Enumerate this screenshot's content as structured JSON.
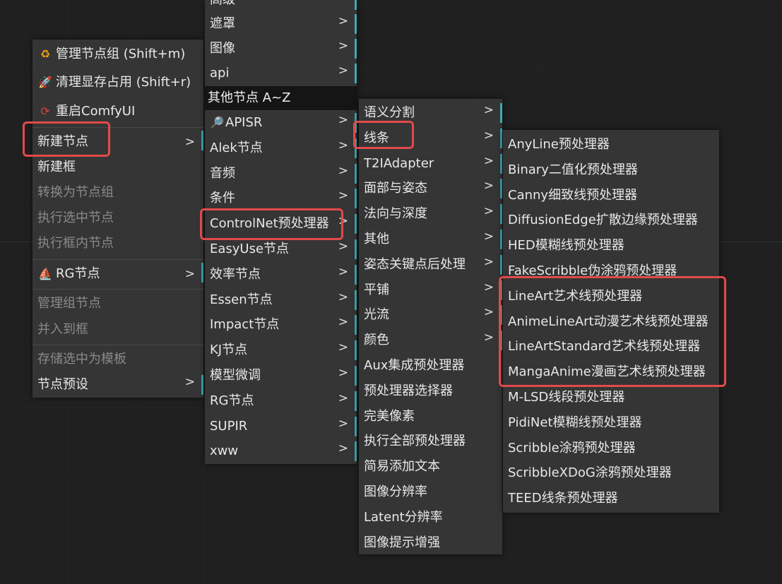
{
  "menu1": {
    "items": [
      {
        "label": "管理节点组 (Shift+m)",
        "icon": "hierarchy-icon"
      },
      {
        "label": "清理显存占用 (Shift+r)",
        "icon": "rocket-icon"
      },
      {
        "label": "重启ComfyUI",
        "icon": "restart-icon"
      },
      {
        "label": "新建节点"
      },
      {
        "label": "新建框"
      },
      {
        "label": "转换为节点组"
      },
      {
        "label": "执行选中节点"
      },
      {
        "label": "执行框内节点"
      },
      {
        "label": "RG节点",
        "icon": "sailboat-icon"
      },
      {
        "label": "管理组节点"
      },
      {
        "label": "并入到框"
      },
      {
        "label": "存储选中为模板"
      },
      {
        "label": "节点预设"
      }
    ]
  },
  "menu2": {
    "top_items": [
      "高级",
      "遮罩",
      "图像",
      "api"
    ],
    "header": "其他节点 A~Z",
    "items": [
      "APISR",
      "Alek节点",
      "音频",
      "条件",
      "ControlNet预处理器",
      "EasyUse节点",
      "效率节点",
      "Essen节点",
      "Impact节点",
      "KJ节点",
      "模型微调",
      "RG节点",
      "SUPIR",
      "xww"
    ]
  },
  "menu3": {
    "items": [
      "语义分割",
      "线条",
      "T2IAdapter",
      "面部与姿态",
      "法向与深度",
      "其他",
      "姿态关键点后处理",
      "平铺",
      "光流",
      "颜色",
      "Aux集成预处理器",
      "预处理器选择器",
      "完美像素",
      "执行全部预处理器",
      "简易添加文本",
      "图像分辨率",
      "Latent分辨率",
      "图像提示增强"
    ]
  },
  "menu4": {
    "items": [
      "AnyLine预处理器",
      "Binary二值化预处理器",
      "Canny细致线预处理器",
      "DiffusionEdge扩散边缘预处理器",
      "HED模糊线预处理器",
      "FakeScribble伪涂鸦预处理器",
      "LineArt艺术线预处理器",
      "AnimeLineArt动漫艺术线预处理器",
      "LineArtStandard艺术线预处理器",
      "MangaAnime漫画艺术线预处理器",
      "M-LSD线段预处理器",
      "PidiNet模糊线预处理器",
      "Scribble涂鸦预处理器",
      "ScribbleXDoG涂鸦预处理器",
      "TEED线条预处理器"
    ]
  },
  "arrow": ">",
  "colors": {
    "highlight": "#e24a4a",
    "submenu_marker": "#3fa9b3",
    "menu_bg": "#353535"
  }
}
